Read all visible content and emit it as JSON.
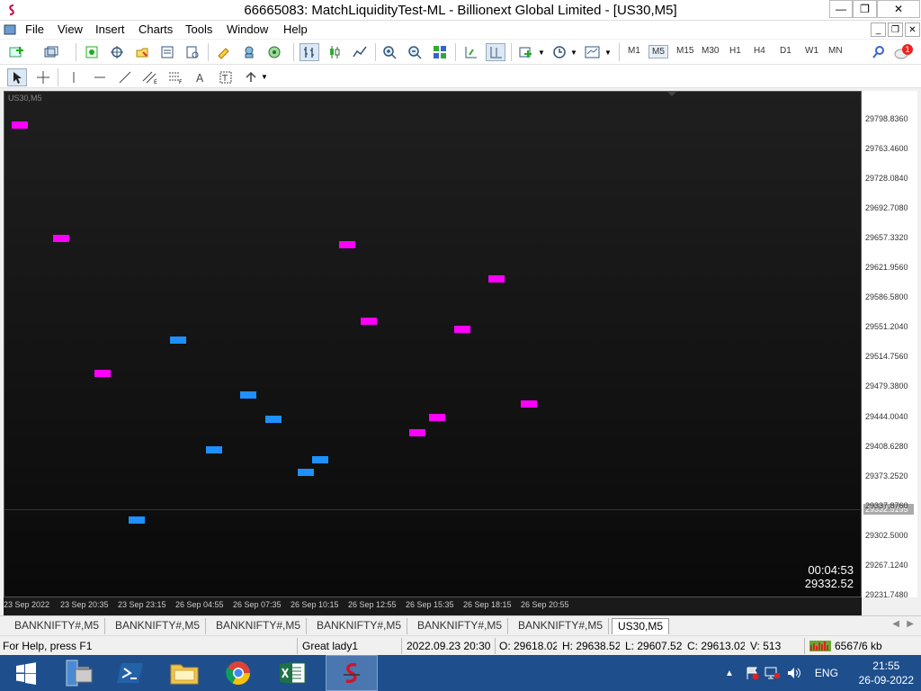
{
  "window": {
    "title": "66665083: MatchLiquidityTest-ML - Billionext Global Limited - [US30,M5]",
    "minimize": "—",
    "restore": "❐",
    "close": "✕"
  },
  "menu": {
    "items": [
      "File",
      "View",
      "Insert",
      "Charts",
      "Tools",
      "Window",
      "Help"
    ]
  },
  "toolbar": {
    "timeframes": [
      "M1",
      "M5",
      "M15",
      "M30",
      "H1",
      "H4",
      "D1",
      "W1",
      "MN"
    ],
    "active_timeframe": "M5",
    "notification_count": "1"
  },
  "chart": {
    "symbol": "US30,M5",
    "price_labels": [
      "29798.8360",
      "29763.4600",
      "29728.0840",
      "29692.7080",
      "29657.3320",
      "29621.9560",
      "29586.5800",
      "29551.2040",
      "29514.7560",
      "29479.3800",
      "29444.0040",
      "29408.6280",
      "29373.2520",
      "29337.8760",
      "29302.5000",
      "29267.1240",
      "29231.7480"
    ],
    "current_price_label": "29332.5195",
    "time_labels": [
      "23 Sep 2022",
      "23 Sep 20:35",
      "23 Sep 23:15",
      "26 Sep 04:55",
      "26 Sep 07:35",
      "26 Sep 10:15",
      "26 Sep 12:55",
      "26 Sep 15:35",
      "26 Sep 18:15",
      "26 Sep 20:55"
    ],
    "countdown": "00:04:53",
    "last_price": "29332.52",
    "colors": {
      "magenta": "#ff00ff",
      "blue": "#1e90ff"
    }
  },
  "tabs": [
    "BANKNIFTY#,M5",
    "BANKNIFTY#,M5",
    "BANKNIFTY#,M5",
    "BANKNIFTY#,M5",
    "BANKNIFTY#,M5",
    "BANKNIFTY#,M5",
    "US30,M5"
  ],
  "status": {
    "help": "For Help, press F1",
    "profile": "Great lady1",
    "datetime": "2022.09.23 20:30",
    "open": "O: 29618.02(",
    "high": "H: 29638.52(",
    "low": "L: 29607.52(",
    "close": "C: 29613.02(",
    "volume": "V: 513",
    "traffic": "6567/6 kb"
  },
  "taskbar": {
    "language": "ENG",
    "time": "21:55",
    "date": "26-09-2022"
  }
}
